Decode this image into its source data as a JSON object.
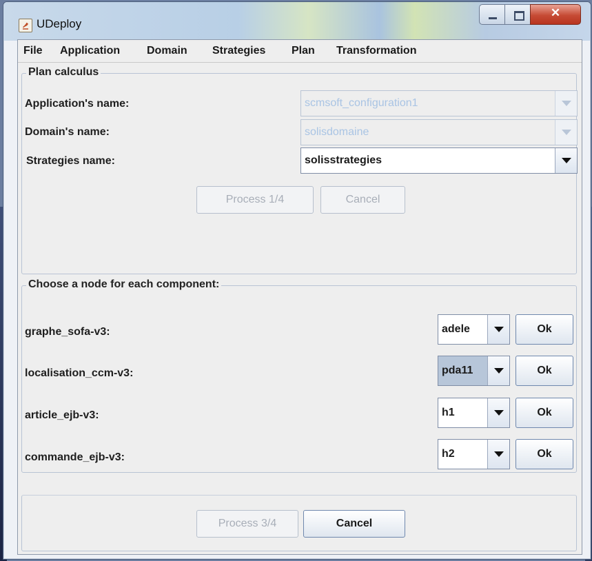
{
  "window": {
    "title": "UDeploy"
  },
  "menu": {
    "items": [
      "File",
      "Application",
      "Domain",
      "Strategies",
      "Plan",
      "Transformation"
    ]
  },
  "plan_calculus": {
    "title": "Plan calculus",
    "rows": [
      {
        "label": "Application's name:",
        "value": "scmsoft_configuration1",
        "enabled": false
      },
      {
        "label": "Domain's name:",
        "value": "solisdomaine",
        "enabled": false
      },
      {
        "label": "Strategies name:",
        "value": "solisstrategies",
        "enabled": true
      }
    ],
    "process_label": "Process 1/4",
    "cancel_label": "Cancel"
  },
  "components": {
    "title": "Choose a node for each component:",
    "rows": [
      {
        "label": "graphe_sofa-v3:",
        "node": "adele",
        "ok": "Ok"
      },
      {
        "label": "localisation_ccm-v3:",
        "node": "pda11",
        "ok": "Ok"
      },
      {
        "label": "article_ejb-v3:",
        "node": "h1",
        "ok": "Ok"
      },
      {
        "label": "commande_ejb-v3:",
        "node": "h2",
        "ok": "Ok"
      }
    ]
  },
  "footer": {
    "process_label": "Process 3/4",
    "cancel_label": "Cancel"
  },
  "icons": [
    "java-app-icon",
    "minimize-icon",
    "maximize-icon",
    "close-icon",
    "chevron-down-icon"
  ]
}
